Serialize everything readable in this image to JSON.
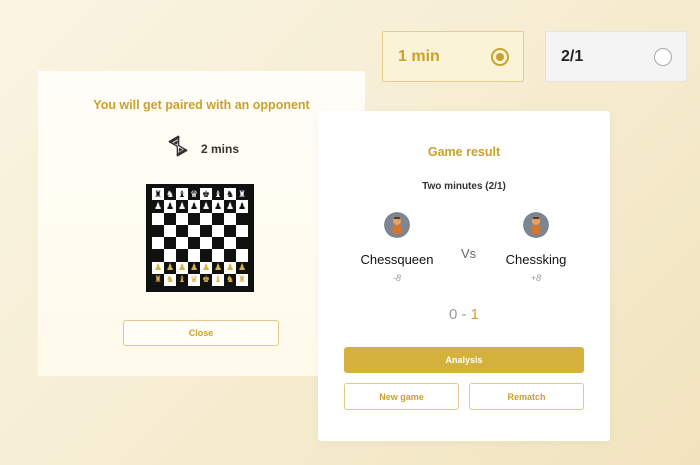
{
  "time_options": [
    {
      "label": "1 min",
      "selected": true
    },
    {
      "label": "2/1",
      "selected": false
    }
  ],
  "pairing": {
    "title": "You will get paired with an opponent",
    "timer_icon": "hourglass-icon",
    "timer_text": "2 mins",
    "close_label": "Close"
  },
  "board": {
    "rows": [
      [
        "r",
        "n",
        "b",
        "q",
        "k",
        "b",
        "n",
        "r"
      ],
      [
        "p",
        "p",
        "p",
        "p",
        "p",
        "p",
        "p",
        "p"
      ],
      [
        "",
        "",
        "",
        "",
        "",
        "",
        "",
        ""
      ],
      [
        "",
        "",
        "",
        "",
        "",
        "",
        "",
        ""
      ],
      [
        "",
        "",
        "",
        "",
        "",
        "",
        "",
        ""
      ],
      [
        "",
        "",
        "",
        "",
        "",
        "",
        "",
        ""
      ],
      [
        "P",
        "P",
        "P",
        "P",
        "P",
        "P",
        "P",
        "P"
      ],
      [
        "R",
        "N",
        "B",
        "Q",
        "K",
        "B",
        "N",
        "R"
      ]
    ]
  },
  "result": {
    "title": "Game result",
    "subtitle": "Two minutes (2/1)",
    "player1": {
      "name": "Chessqueen",
      "delta": "-8"
    },
    "vs": "Vs",
    "player2": {
      "name": "Chessking",
      "delta": "+8"
    },
    "score_left": "0",
    "score_sep": " - ",
    "score_right": "1",
    "analysis_label": "Analysis",
    "new_game_label": "New game",
    "rematch_label": "Rematch"
  },
  "colors": {
    "accent": "#c8a22a",
    "button_fill": "#d4b13d"
  }
}
